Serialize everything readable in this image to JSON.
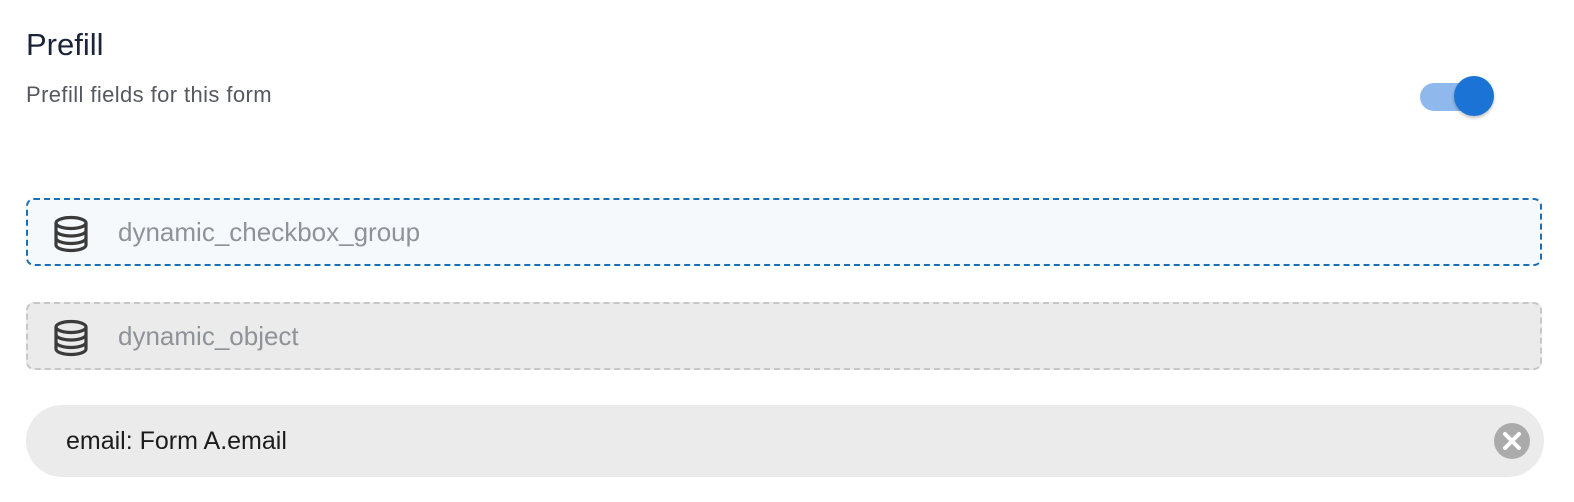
{
  "section": {
    "title": "Prefill",
    "subtitle": "Prefill fields for this form"
  },
  "toggle": {
    "state": "on",
    "accent_color": "#1a73d5"
  },
  "fields": [
    {
      "label": "dynamic_checkbox_group",
      "icon": "database-icon",
      "state": "active"
    },
    {
      "label": "dynamic_object",
      "icon": "database-icon",
      "state": "inactive"
    }
  ],
  "mapping_chip": {
    "label": "email: Form A.email",
    "remove_icon": "close-circle-icon"
  }
}
